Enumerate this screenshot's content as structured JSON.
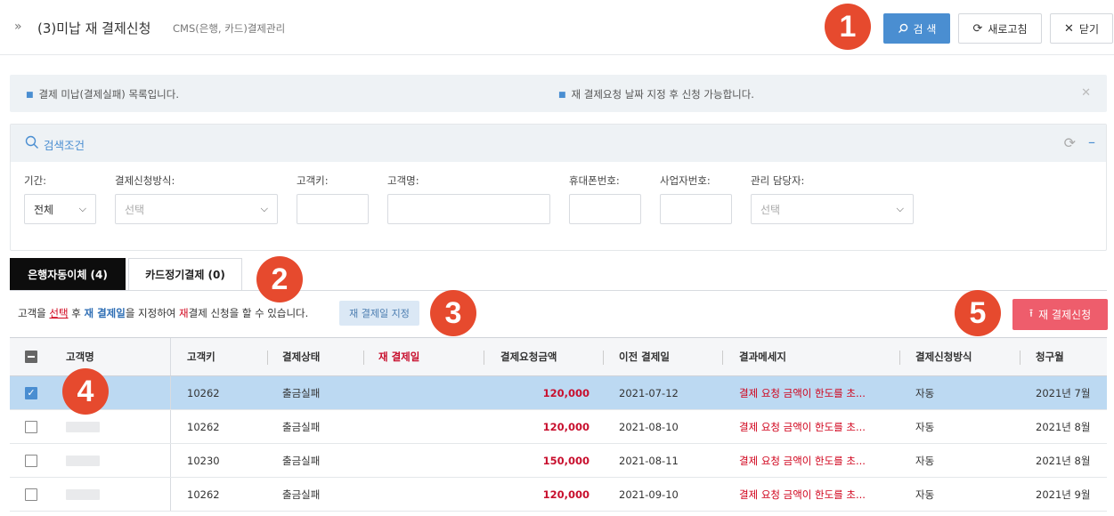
{
  "header": {
    "title": "(3)미납 재 결제신청",
    "subtitle": "CMS(은행, 카드)결제관리",
    "search_label": "검 색",
    "refresh_label": "새로고침",
    "close_label": "닫기"
  },
  "badges": [
    "1",
    "2",
    "3",
    "4",
    "5"
  ],
  "info": {
    "msg1": "결제 미납(결제실패) 목록입니다.",
    "msg2": "재 결제요청 날짜 지정 후 신청 가능합니다."
  },
  "search_panel": {
    "title": "검색조건",
    "fields": {
      "period_label": "기간:",
      "period_value": "전체",
      "method_label": "결제신청방식:",
      "method_placeholder": "선택",
      "custkey_label": "고객키:",
      "custname_label": "고객명:",
      "phone_label": "휴대폰번호:",
      "bizno_label": "사업자번호:",
      "manager_label": "관리 담당자:",
      "manager_placeholder": "선택"
    }
  },
  "tabs": {
    "bank": "은행자동이체 (4)",
    "card": "카드정기결제 (0)"
  },
  "guide": {
    "p1": "고객을 ",
    "select": "선택",
    "p2": " 후 ",
    "redate": "재 결제일",
    "p3": "을 지정하여 ",
    "re": "재",
    "p4": "결제 신청을 할 수 있습니다."
  },
  "buttons": {
    "set_date": "재 결제일 지정",
    "apply": "재 결제신청"
  },
  "table": {
    "headers": [
      "고객명",
      "고객키",
      "결제상태",
      "재 결제일",
      "결제요청금액",
      "이전 결제일",
      "결과메세지",
      "결제신청방식",
      "청구월"
    ],
    "rows": [
      {
        "key": "10262",
        "status": "출금실패",
        "redate": "",
        "amount": "120,000",
        "prev": "2021-07-12",
        "msg": "결제 요청 금액이 한도를 초...",
        "method": "자동",
        "month": "2021년 7월"
      },
      {
        "key": "10262",
        "status": "출금실패",
        "redate": "",
        "amount": "120,000",
        "prev": "2021-08-10",
        "msg": "결제 요청 금액이 한도를 초...",
        "method": "자동",
        "month": "2021년 8월"
      },
      {
        "key": "10230",
        "status": "출금실패",
        "redate": "",
        "amount": "150,000",
        "prev": "2021-08-11",
        "msg": "결제 요청 금액이 한도를 초...",
        "method": "자동",
        "month": "2021년 8월"
      },
      {
        "key": "10262",
        "status": "출금실패",
        "redate": "",
        "amount": "120,000",
        "prev": "2021-09-10",
        "msg": "결제 요청 금액이 한도를 초...",
        "method": "자동",
        "month": "2021년 9월"
      }
    ]
  },
  "colors": {
    "primary": "#4a8ed1",
    "badge": "#e64a2e",
    "apply": "#ee5d6c",
    "selected_row": "#bcd9f2"
  }
}
